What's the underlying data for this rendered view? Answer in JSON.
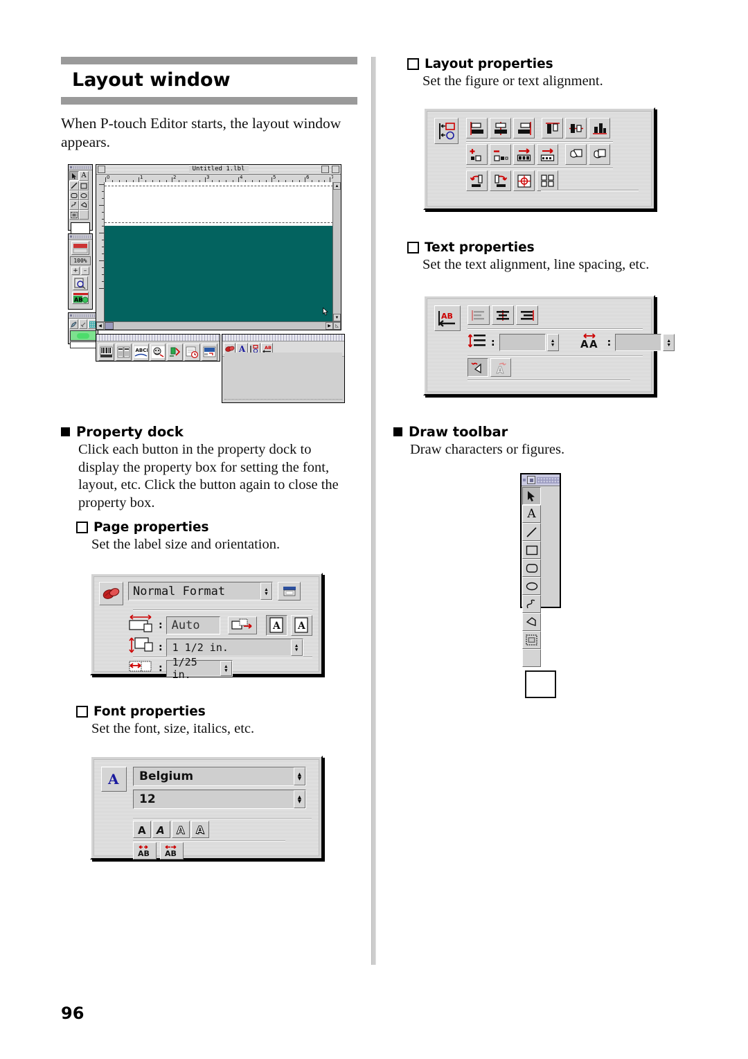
{
  "document": {
    "page_number": "96",
    "title": "Layout window",
    "intro": "When P-touch Editor starts, the layout window appears."
  },
  "left_column": {
    "property_dock": {
      "bullet": "filled-square",
      "heading": "Property dock",
      "body": "Click each button in the property dock to display the property box for setting the font, layout, etc. Click the button again to close the property box."
    },
    "page_properties": {
      "bullet": "open-square",
      "heading": "Page properties",
      "body": "Set the label size and orientation.",
      "panel": {
        "format_value": "Normal Format",
        "length_value": "Auto",
        "width_value": "1 1/2 in.",
        "margin_value": "1/25 in.",
        "icons": {
          "page_icon": "page-properties-icon",
          "print_icon": "printer-icon",
          "length_icon": "label-length-icon",
          "autolength_icon": "auto-length-icon",
          "orientation_landscape_icon": "orientation-landscape-icon",
          "orientation_portrait_icon": "orientation-portrait-icon",
          "width_icon": "label-width-icon",
          "margin_icon": "label-margin-icon"
        }
      }
    },
    "font_properties": {
      "bullet": "open-square",
      "heading": "Font properties",
      "body": "Set the font, size, italics, etc.",
      "panel": {
        "font_value": "Belgium",
        "size_value": "12",
        "style_buttons": [
          "A",
          "A",
          "A",
          "A"
        ],
        "spacing_buttons": [
          "AB",
          "AB"
        ],
        "icons": {
          "font_icon": "font-properties-icon",
          "bold_icon": "bold-icon",
          "italic_icon": "italic-icon",
          "outline_icon": "outline-icon",
          "shadow_icon": "shadow-icon",
          "char_spacing_narrow_icon": "char-spacing-narrow-icon",
          "char_spacing_wide_icon": "char-spacing-wide-icon"
        }
      }
    }
  },
  "right_column": {
    "layout_properties": {
      "bullet": "open-square",
      "heading": "Layout properties",
      "body": "Set the figure or text alignment.",
      "panel": {
        "icons": {
          "layout_icon": "layout-properties-icon",
          "row1": [
            "align-left-icon",
            "align-center-horizontal-icon",
            "align-right-icon",
            "align-top-icon",
            "align-middle-vertical-icon",
            "align-bottom-icon"
          ],
          "row2": [
            "add-object-icon",
            "remove-object-icon",
            "distribute-horizontal-icon",
            "distribute-even-icon",
            "bring-to-front-icon",
            "send-to-back-icon"
          ],
          "row3": [
            "rotate-left-icon",
            "rotate-right-icon",
            "center-target-icon",
            "grid-icon"
          ]
        }
      }
    },
    "text_properties": {
      "bullet": "open-square",
      "heading": "Text properties",
      "body": "Set the text alignment, line spacing, etc.",
      "panel": {
        "line_spacing_value": "",
        "char_spacing_value": "",
        "icons": {
          "text_icon": "text-properties-icon",
          "align_left_icon": "text-align-left-icon",
          "align_center_icon": "text-align-center-icon",
          "align_right_icon": "text-align-right-icon",
          "line_spacing_icon": "line-spacing-icon",
          "char_spacing_icon": "character-spacing-icon",
          "vertical_text_icon": "vertical-text-icon",
          "rotate_text_icon": "rotate-text-icon"
        }
      }
    },
    "draw_toolbar": {
      "bullet": "filled-square",
      "heading": "Draw toolbar",
      "body": "Draw characters or figures.",
      "palette": {
        "tools": [
          "arrow-select-icon",
          "text-tool-icon",
          "line-tool-icon",
          "rectangle-tool-icon",
          "rounded-rectangle-tool-icon",
          "ellipse-tool-icon",
          "freehand-tool-icon",
          "polygon-tool-icon",
          "clipart-tool-icon",
          "blank-tool-icon"
        ],
        "swatch": "white-swatch"
      }
    }
  },
  "layout_window_screenshot": {
    "window_title": "Untitled 1.lbl",
    "ruler_units": [
      "0",
      "1",
      "2",
      "3",
      "4",
      "5",
      "6",
      "7"
    ],
    "zoom_value": "100%",
    "zoom_in_label": "+",
    "zoom_out_label": "−",
    "canvas": {
      "paper_color": "#ffffff",
      "label_color": "#03635f"
    },
    "draw_palette_tools": [
      "arrow-select-icon",
      "text-tool-icon",
      "line-tool-icon",
      "rectangle-tool-icon",
      "rounded-rectangle-tool-icon",
      "ellipse-tool-icon",
      "freehand-tool-icon",
      "polygon-tool-icon",
      "clipart-tool-icon",
      "blank-tool-icon"
    ],
    "view_palette_icons": [
      "print-preview-icon",
      "zoom-in-icon",
      "zoom-out-icon",
      "magnify-icon",
      "ab-color-icon"
    ],
    "color_palette_icons": [
      "pen-icon",
      "brush-icon",
      "grid-icon"
    ],
    "object_toolbar_icons": [
      "barcode-icon",
      "database-icon",
      "arc-text-icon",
      "clipart-icon",
      "symbol-icon",
      "date-time-icon",
      "layout-object-icon"
    ],
    "property_dock_buttons": [
      "page-properties-icon",
      "font-properties-icon",
      "layout-properties-icon",
      "text-properties-icon"
    ]
  },
  "colors": {
    "rule_gray": "#9a9a9a",
    "divider_gray": "#cdcdcd",
    "label_teal": "#03635f",
    "accent_red": "#cc0000",
    "accent_blue": "#1a1a9e"
  }
}
